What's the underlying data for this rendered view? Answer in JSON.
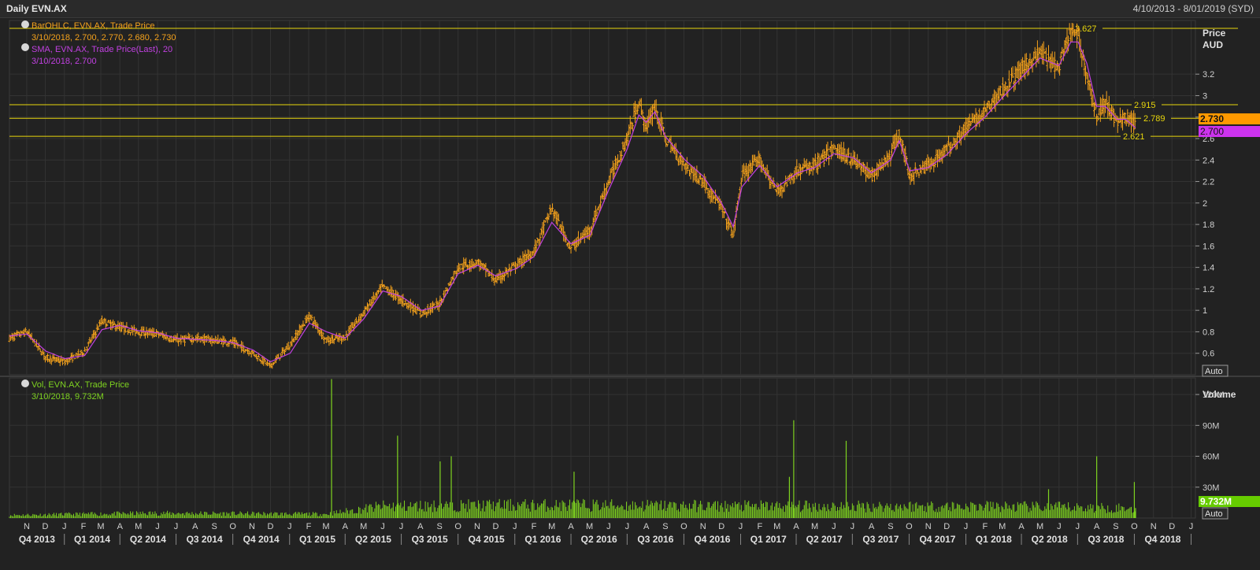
{
  "window": {
    "title": "Daily EVN.AX",
    "date_range": "4/10/2013 - 8/01/2019 (SYD)"
  },
  "legend": {
    "ohlc_label": "BarOHLC, EVN.AX, Trade Price",
    "ohlc_value": "3/10/2018, 2.700, 2.770, 2.680, 2.730",
    "sma_label": "SMA, EVN.AX, Trade Price(Last),  20",
    "sma_value": "3/10/2018, 2.700",
    "vol_label": "Vol, EVN.AX, Trade Price",
    "vol_value": "3/10/2018, 9.732M"
  },
  "axis": {
    "price_title_1": "Price",
    "price_title_2": "AUD",
    "volume_title": "Volume",
    "auto_label": "Auto",
    "price_ticks": [
      "0.6",
      "0.8",
      "1",
      "1.2",
      "1.4",
      "1.6",
      "1.8",
      "2",
      "2.2",
      "2.4",
      "2.6",
      "2.8",
      "3",
      "3.2"
    ],
    "volume_ticks": [
      "30M",
      "60M",
      "90M",
      "120M"
    ]
  },
  "markers": {
    "last_price": "2.730",
    "last_sma": "2.700",
    "last_volume": "9.732M"
  },
  "colors": {
    "background": "#222222",
    "grid": "#333333",
    "price_bars": "#f5a21c",
    "sma": "#c040e0",
    "volume": "#7ed320",
    "levels": "#e8d60c",
    "text": "#d0d0d0",
    "last_price_bg": "#ff9900",
    "last_sma_bg": "#cc33ee",
    "last_volume_bg": "#66cc00"
  },
  "chart_data": [
    {
      "type": "line",
      "chart": "price",
      "title": "Daily EVN.AX",
      "ylabel": "Price AUD",
      "ylim": [
        0.4,
        3.7
      ],
      "x_range": [
        "2013-10-04",
        "2019-01-08"
      ],
      "price_series": {
        "name": "BarOHLC, EVN.AX, Trade Price",
        "style": "ohlc-bars",
        "x": [
          "2013-10-04",
          "2013-11-01",
          "2013-12-02",
          "2014-01-02",
          "2014-02-03",
          "2014-03-03",
          "2014-04-01",
          "2014-05-01",
          "2014-06-02",
          "2014-07-01",
          "2014-08-01",
          "2014-09-01",
          "2014-10-01",
          "2014-11-03",
          "2014-12-01",
          "2015-01-02",
          "2015-02-02",
          "2015-03-02",
          "2015-04-01",
          "2015-05-01",
          "2015-06-01",
          "2015-07-01",
          "2015-08-03",
          "2015-09-01",
          "2015-10-01",
          "2015-11-02",
          "2015-12-01",
          "2016-01-04",
          "2016-02-01",
          "2016-03-01",
          "2016-04-01",
          "2016-05-02",
          "2016-06-01",
          "2016-07-01",
          "2016-07-20",
          "2016-08-01",
          "2016-08-15",
          "2016-09-01",
          "2016-10-03",
          "2016-11-01",
          "2016-12-01",
          "2016-12-20",
          "2017-01-03",
          "2017-02-01",
          "2017-03-01",
          "2017-04-03",
          "2017-05-01",
          "2017-06-01",
          "2017-07-03",
          "2017-08-01",
          "2017-09-01",
          "2017-09-15",
          "2017-10-02",
          "2017-11-01",
          "2017-12-01",
          "2018-01-02",
          "2018-02-01",
          "2018-03-01",
          "2018-04-03",
          "2018-05-01",
          "2018-06-01",
          "2018-06-20",
          "2018-07-02",
          "2018-07-16",
          "2018-08-01",
          "2018-08-15",
          "2018-09-03",
          "2018-09-17",
          "2018-10-03"
        ],
        "values": [
          0.74,
          0.8,
          0.56,
          0.52,
          0.62,
          0.9,
          0.84,
          0.8,
          0.78,
          0.72,
          0.74,
          0.72,
          0.7,
          0.6,
          0.48,
          0.68,
          0.95,
          0.72,
          0.75,
          0.98,
          1.22,
          1.1,
          0.97,
          1.06,
          1.4,
          1.45,
          1.28,
          1.42,
          1.55,
          1.95,
          1.58,
          1.75,
          2.2,
          2.6,
          2.95,
          2.7,
          2.9,
          2.6,
          2.35,
          2.2,
          1.95,
          1.7,
          2.25,
          2.4,
          2.1,
          2.3,
          2.35,
          2.5,
          2.4,
          2.25,
          2.45,
          2.65,
          2.25,
          2.35,
          2.5,
          2.7,
          2.85,
          3.05,
          3.25,
          3.4,
          3.25,
          3.6,
          3.55,
          3.2,
          2.8,
          2.95,
          2.75,
          2.8,
          2.73
        ]
      },
      "sma_series": {
        "name": "SMA, EVN.AX, Trade Price(Last),  20",
        "x": [
          "2013-10-04",
          "2013-11-01",
          "2013-12-02",
          "2014-01-02",
          "2014-02-03",
          "2014-03-03",
          "2014-04-01",
          "2014-05-01",
          "2014-06-02",
          "2014-07-01",
          "2014-08-01",
          "2014-09-01",
          "2014-10-01",
          "2014-11-03",
          "2014-12-01",
          "2015-01-02",
          "2015-02-02",
          "2015-03-02",
          "2015-04-01",
          "2015-05-01",
          "2015-06-01",
          "2015-07-01",
          "2015-08-03",
          "2015-09-01",
          "2015-10-01",
          "2015-11-02",
          "2015-12-01",
          "2016-01-04",
          "2016-02-01",
          "2016-03-01",
          "2016-04-01",
          "2016-05-02",
          "2016-06-01",
          "2016-07-01",
          "2016-07-20",
          "2016-08-01",
          "2016-08-15",
          "2016-09-01",
          "2016-10-03",
          "2016-11-01",
          "2016-12-01",
          "2016-12-20",
          "2017-01-03",
          "2017-02-01",
          "2017-03-01",
          "2017-04-03",
          "2017-05-01",
          "2017-06-01",
          "2017-07-03",
          "2017-08-01",
          "2017-09-01",
          "2017-09-15",
          "2017-10-02",
          "2017-11-01",
          "2017-12-01",
          "2018-01-02",
          "2018-02-01",
          "2018-03-01",
          "2018-04-03",
          "2018-05-01",
          "2018-06-01",
          "2018-06-20",
          "2018-07-02",
          "2018-07-16",
          "2018-08-01",
          "2018-08-15",
          "2018-09-03",
          "2018-09-17",
          "2018-10-03"
        ],
        "values": [
          0.76,
          0.78,
          0.62,
          0.55,
          0.58,
          0.82,
          0.86,
          0.81,
          0.79,
          0.74,
          0.73,
          0.72,
          0.7,
          0.63,
          0.52,
          0.6,
          0.88,
          0.8,
          0.74,
          0.92,
          1.18,
          1.13,
          1.0,
          1.04,
          1.34,
          1.42,
          1.32,
          1.39,
          1.5,
          1.82,
          1.62,
          1.7,
          2.12,
          2.5,
          2.82,
          2.75,
          2.85,
          2.62,
          2.4,
          2.25,
          2.0,
          1.78,
          2.15,
          2.35,
          2.15,
          2.28,
          2.33,
          2.46,
          2.42,
          2.28,
          2.4,
          2.58,
          2.3,
          2.33,
          2.45,
          2.65,
          2.8,
          2.98,
          3.18,
          3.35,
          3.28,
          3.5,
          3.5,
          3.3,
          2.9,
          2.9,
          2.78,
          2.78,
          2.7
        ]
      },
      "levels": [
        {
          "value": 3.627,
          "label": "3.627"
        },
        {
          "value": 2.915,
          "label": "2.915"
        },
        {
          "value": 2.789,
          "label": "2.789"
        },
        {
          "value": 2.621,
          "label": "2.621"
        }
      ],
      "x_months": [
        "N",
        "D",
        "J",
        "F",
        "M",
        "A",
        "M",
        "J",
        "J",
        "A",
        "S",
        "O",
        "N",
        "D",
        "J",
        "F",
        "M",
        "A",
        "M",
        "J",
        "J",
        "A",
        "S",
        "O",
        "N",
        "D",
        "J",
        "F",
        "M",
        "A",
        "M",
        "J",
        "J",
        "A",
        "S",
        "O",
        "N",
        "D",
        "J",
        "F",
        "M",
        "A",
        "M",
        "J",
        "J",
        "A",
        "S",
        "O",
        "N",
        "D",
        "J",
        "F",
        "M",
        "A",
        "M",
        "J",
        "J",
        "A",
        "S",
        "O",
        "N",
        "D",
        "J"
      ],
      "x_quarters": [
        "Q4 2013",
        "Q1 2014",
        "Q2 2014",
        "Q3 2014",
        "Q4 2014",
        "Q1 2015",
        "Q2 2015",
        "Q3 2015",
        "Q4 2015",
        "Q1 2016",
        "Q2 2016",
        "Q3 2016",
        "Q4 2016",
        "Q1 2017",
        "Q2 2017",
        "Q3 2017",
        "Q4 2017",
        "Q1 2018",
        "Q2 2018",
        "Q3 2018",
        "Q4 2018"
      ],
      "grid": true,
      "legend": "top-left"
    },
    {
      "type": "bar",
      "chart": "volume",
      "name": "Vol, EVN.AX, Trade Price",
      "ylabel": "Volume",
      "ylim": [
        0,
        130000000
      ],
      "baseline_x": [
        "2013-10-04",
        "2014-06-01",
        "2015-03-01",
        "2015-06-01",
        "2016-01-01",
        "2016-06-01",
        "2017-01-01",
        "2017-06-01",
        "2018-01-01",
        "2018-06-01",
        "2018-10-03"
      ],
      "baseline_values": [
        3000000,
        5000000,
        4000000,
        12000000,
        13000000,
        13000000,
        12000000,
        12000000,
        12000000,
        11000000,
        10000000
      ],
      "spikes": [
        {
          "x": "2015-03-10",
          "value": 135000000
        },
        {
          "x": "2015-06-25",
          "value": 80000000
        },
        {
          "x": "2015-09-02",
          "value": 55000000
        },
        {
          "x": "2015-09-20",
          "value": 60000000
        },
        {
          "x": "2016-04-06",
          "value": 45000000
        },
        {
          "x": "2017-03-21",
          "value": 40000000
        },
        {
          "x": "2017-03-28",
          "value": 95000000
        },
        {
          "x": "2017-06-21",
          "value": 75000000
        },
        {
          "x": "2018-05-15",
          "value": 28000000
        },
        {
          "x": "2018-08-01",
          "value": 60000000
        },
        {
          "x": "2018-10-01",
          "value": 35000000
        },
        {
          "x": "2018-10-03",
          "value": 9732000
        }
      ],
      "last_value": "9.732M",
      "legend": "top-left"
    }
  ]
}
